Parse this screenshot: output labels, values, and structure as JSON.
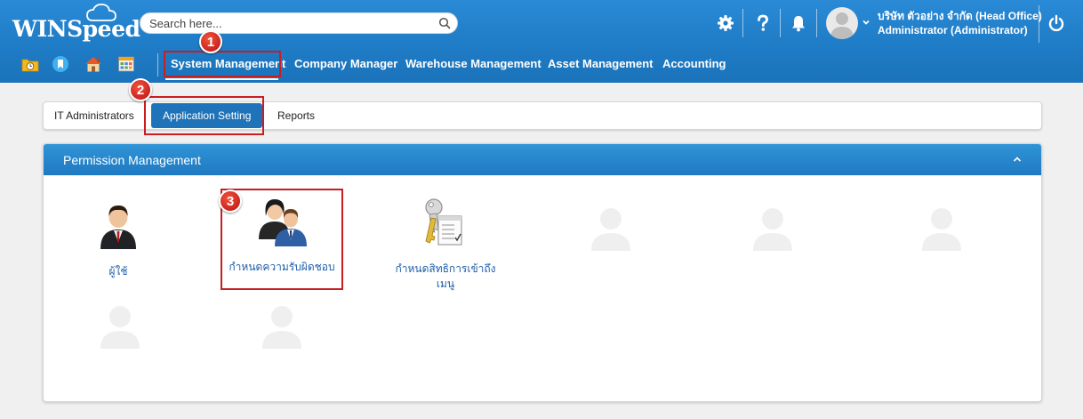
{
  "brand": {
    "name": "WINSpeed"
  },
  "search": {
    "placeholder": "Search here..."
  },
  "header": {
    "icons": [
      "gear-icon",
      "question-icon",
      "bell-icon",
      "power-icon"
    ],
    "company": "บริษัท ตัวอย่าง จำกัด (Head Office)",
    "user": "Administrator (Administrator)"
  },
  "quick_icons": [
    "folder-clock-icon",
    "bookmark-icon",
    "home-icon",
    "calendar-grid-icon"
  ],
  "menu": {
    "items": [
      "System Management",
      "Company Manager",
      "Warehouse Management",
      "Asset Management",
      "Accounting"
    ],
    "active": "System Management"
  },
  "tabs": {
    "items": [
      "IT Administrators",
      "Application Setting",
      "Reports"
    ],
    "active": "Application Setting"
  },
  "panel": {
    "title": "Permission Management",
    "tiles": [
      {
        "label": "ผู้ใช้",
        "icon": "user-icon"
      },
      {
        "label": "กำหนดความรับผิดชอบ",
        "icon": "users-group-icon"
      },
      {
        "label": "กำหนดสิทธิการเข้าถึงเมนู",
        "icon": "key-checklist-icon"
      }
    ]
  },
  "annotations": {
    "badges": [
      "1",
      "2",
      "3"
    ],
    "color": "#c81e22"
  },
  "colors": {
    "header": "#1f7cc6",
    "panel_header": "#2a88cc",
    "active_tab": "#1f73b9",
    "link": "#1f5fa8"
  }
}
